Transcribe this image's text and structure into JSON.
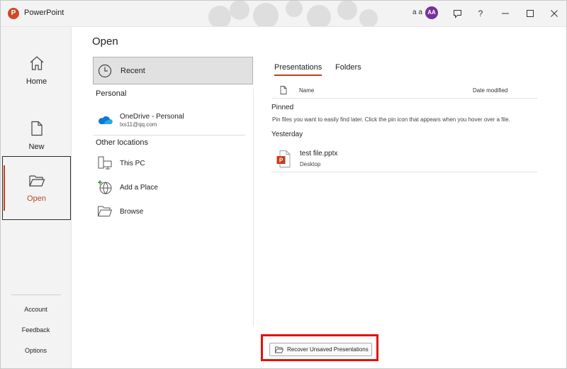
{
  "app": {
    "logo": "P",
    "title": "PowerPoint"
  },
  "account": {
    "user_name": "a a",
    "avatar_initials": "AA",
    "avatar_color": "#7a2e9c"
  },
  "titlebar": {
    "buttons": [
      "feedback-icon",
      "help-icon",
      "minimize-icon",
      "maximize-icon",
      "close-icon"
    ],
    "help_label": "?"
  },
  "sidebar": {
    "items": [
      {
        "label": "Home",
        "icon": "home-icon"
      },
      {
        "label": "New",
        "icon": "new-document-icon"
      },
      {
        "label": "Open",
        "icon": "open-folder-icon",
        "selected": true
      }
    ],
    "bottom_links": [
      "Account",
      "Feedback",
      "Options"
    ]
  },
  "main": {
    "title": "Open",
    "recent_label": "Recent",
    "personal_heading": "Personal",
    "onedrive": {
      "name": "OneDrive - Personal",
      "email": "lxs11@qq.com"
    },
    "other_heading": "Other locations",
    "locations": [
      {
        "label": "This PC",
        "icon": "computer-icon"
      },
      {
        "label": "Add a Place",
        "icon": "add-place-icon"
      },
      {
        "label": "Browse",
        "icon": "browse-folder-icon"
      }
    ]
  },
  "files_panel": {
    "tabs": [
      {
        "label": "Presentations",
        "active": true
      },
      {
        "label": "Folders",
        "active": false
      }
    ],
    "columns": {
      "name": "Name",
      "date": "Date modified"
    },
    "pinned_heading": "Pinned",
    "pinned_hint": "Pin files you want to easily find later. Click the pin icon that appears when you hover over a file.",
    "yesterday_heading": "Yesterday",
    "files": [
      {
        "name": "test file.pptx",
        "location": "Desktop"
      }
    ]
  },
  "recover_button": {
    "label": "Recover Unsaved Presentations"
  },
  "colors": {
    "accent": "#c43e1c",
    "brand": "#d24726",
    "highlight_box": "#e3120b",
    "selected_bg": "#e1e1e1"
  }
}
